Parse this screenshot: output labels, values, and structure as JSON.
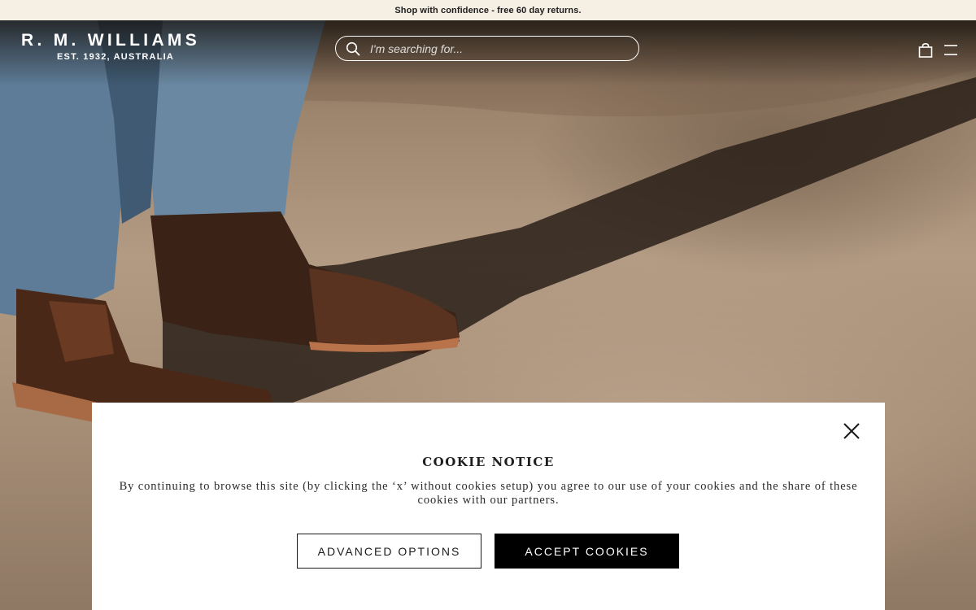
{
  "promo": {
    "text": "Shop with confidence - free 60 day returns."
  },
  "header": {
    "logo_brand": "R. M. WILLIAMS",
    "logo_sub": "EST. 1932, AUSTRALIA",
    "search_placeholder": "I'm searching for...",
    "icons": [
      "search-icon",
      "shopping-bag-icon",
      "hamburger-menu-icon"
    ]
  },
  "cookie_notice": {
    "title": "COOKIE NOTICE",
    "body": "By continuing to browse this site (by clicking the ‘x’ without cookies setup) you agree to our use of your cookies and the share of these cookies with our partners.",
    "advanced_label": "ADVANCED OPTIONS",
    "accept_label": "ACCEPT COOKIES",
    "close_icon": "close-icon"
  },
  "colors": {
    "promo_bg": "#f6efe4",
    "accept_bg": "#000000",
    "text_dark": "#1f1f1f"
  }
}
